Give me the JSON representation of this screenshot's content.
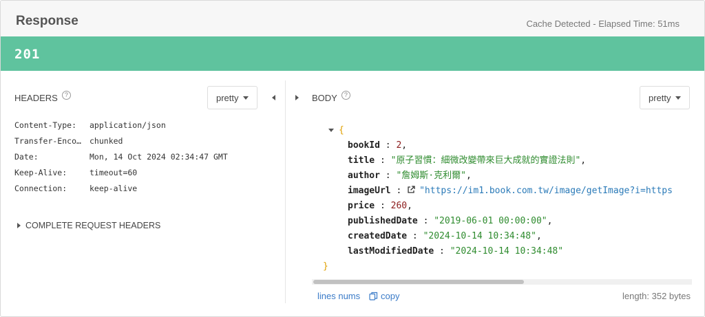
{
  "header": {
    "title": "Response",
    "cache_info": "Cache Detected - Elapsed Time: 51ms"
  },
  "status": {
    "code": "201",
    "color": "#5fc39e"
  },
  "headers_panel": {
    "title": "HEADERS",
    "format": "pretty",
    "rows": [
      {
        "key": "Content-Type:",
        "value": "application/json"
      },
      {
        "key": "Transfer-Enco…",
        "value": "chunked"
      },
      {
        "key": "Date:",
        "value": "Mon, 14 Oct 2024 02:34:47 GMT"
      },
      {
        "key": "Keep-Alive:",
        "value": "timeout=60"
      },
      {
        "key": "Connection:",
        "value": "keep-alive"
      }
    ],
    "complete_request_label": "COMPLETE REQUEST HEADERS"
  },
  "body_panel": {
    "title": "BODY",
    "format": "pretty",
    "open_brace": "{",
    "close_brace": "}",
    "fields": {
      "bookId": {
        "key": "bookId",
        "value": "2"
      },
      "title": {
        "key": "title",
        "value": "\"原子習慣：細微改變帶來巨大成就的實證法則\""
      },
      "author": {
        "key": "author",
        "value": "\"詹姆斯·克利爾\""
      },
      "imageUrl": {
        "key": "imageUrl",
        "value": "\"https://im1.book.com.tw/image/getImage?i=https"
      },
      "price": {
        "key": "price",
        "value": "260"
      },
      "publishedDate": {
        "key": "publishedDate",
        "value": "\"2019-06-01 00:00:00\""
      },
      "createdDate": {
        "key": "createdDate",
        "value": "\"2024-10-14 10:34:48\""
      },
      "lastModifiedDate": {
        "key": "lastModifiedDate",
        "value": "\"2024-10-14 10:34:48\""
      }
    },
    "footer": {
      "lines_nums": "lines nums",
      "copy": "copy",
      "length": "length: 352 bytes"
    }
  },
  "icons": [
    "help-icon",
    "chevron-down-icon",
    "collapse-left-icon",
    "expand-right-icon",
    "fold-icon",
    "external-link-icon",
    "copy-icon"
  ]
}
